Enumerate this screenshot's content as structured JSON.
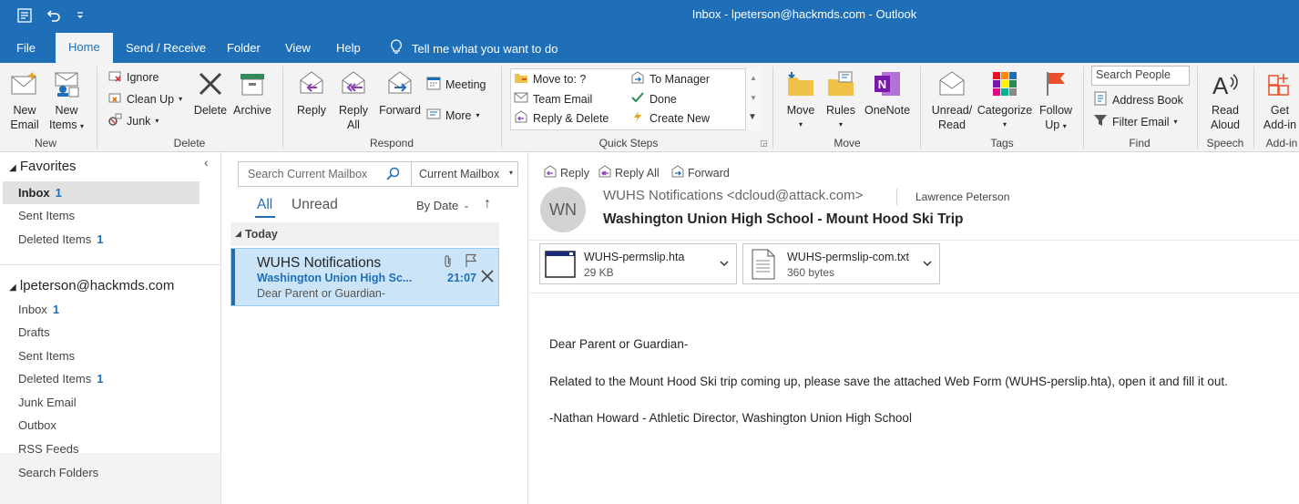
{
  "titlebar": {
    "title": "Inbox - lpeterson@hackmds.com  -  Outlook"
  },
  "tabs": [
    {
      "label": "File",
      "active": false
    },
    {
      "label": "Home",
      "active": true
    },
    {
      "label": "Send / Receive",
      "active": false
    },
    {
      "label": "Folder",
      "active": false
    },
    {
      "label": "View",
      "active": false
    },
    {
      "label": "Help",
      "active": false
    }
  ],
  "tell_me": "Tell me what you want to do",
  "ribbon": {
    "new": {
      "new_email_1": "New",
      "new_email_2": "Email",
      "new_items_1": "New",
      "new_items_2": "Items",
      "group": "New"
    },
    "delete": {
      "ignore": "Ignore",
      "clean_up": "Clean Up",
      "junk": "Junk",
      "delete": "Delete",
      "archive": "Archive",
      "group": "Delete"
    },
    "respond": {
      "reply": "Reply",
      "reply_all_1": "Reply",
      "reply_all_2": "All",
      "forward": "Forward",
      "meeting": "Meeting",
      "more": "More",
      "group": "Respond"
    },
    "quick_steps": {
      "move_to": "Move to: ?",
      "team_email": "Team Email",
      "reply_delete": "Reply & Delete",
      "to_manager": "To Manager",
      "done": "Done",
      "create_new": "Create New",
      "group": "Quick Steps"
    },
    "move": {
      "move": "Move",
      "rules": "Rules",
      "onenote": "OneNote",
      "group": "Move"
    },
    "tags": {
      "unread_read_1": "Unread/",
      "unread_read_2": "Read",
      "categorize": "Categorize",
      "follow_up_1": "Follow",
      "follow_up_2": "Up",
      "group": "Tags"
    },
    "find": {
      "search_people": "Search People",
      "address_book": "Address Book",
      "filter_email": "Filter Email",
      "group": "Find"
    },
    "speech": {
      "read_aloud_1": "Read",
      "read_aloud_2": "Aloud",
      "group": "Speech"
    },
    "addins": {
      "get_addins_1": "Get",
      "get_addins_2": "Add-in",
      "group": "Add-in"
    }
  },
  "folders": {
    "favorites_header": "Favorites",
    "favorites": [
      {
        "label": "Inbox",
        "count": "1"
      },
      {
        "label": "Sent Items",
        "count": ""
      },
      {
        "label": "Deleted Items",
        "count": "1"
      }
    ],
    "account_header": "lpeterson@hackmds.com",
    "account_items": [
      {
        "label": "Inbox",
        "count": "1"
      },
      {
        "label": "Drafts",
        "count": ""
      },
      {
        "label": "Sent Items",
        "count": ""
      },
      {
        "label": "Deleted Items",
        "count": "1"
      },
      {
        "label": "Junk Email",
        "count": ""
      },
      {
        "label": "Outbox",
        "count": ""
      },
      {
        "label": "RSS Feeds",
        "count": ""
      },
      {
        "label": "Search Folders",
        "count": ""
      }
    ]
  },
  "message_list": {
    "search_placeholder": "Search Current Mailbox",
    "scope": "Current Mailbox",
    "filter_all": "All",
    "filter_unread": "Unread",
    "sort": "By Date",
    "group_today": "Today",
    "message": {
      "sender": "WUHS Notifications",
      "subject": "Washington Union High Sc...",
      "time": "21:07",
      "preview": "Dear Parent or Guardian-"
    }
  },
  "reading": {
    "actions": {
      "reply": "Reply",
      "reply_all": "Reply All",
      "forward": "Forward"
    },
    "avatar": "WN",
    "from": "WUHS Notifications <dcloud@attack.com>",
    "to": "Lawrence Peterson",
    "subject": "Washington Union High School - Mount Hood Ski Trip",
    "attachments": [
      {
        "name": "WUHS-permslip.hta",
        "size": "29 KB"
      },
      {
        "name": "WUHS-permslip-com.txt",
        "size": "360 bytes"
      }
    ],
    "body": [
      "Dear Parent or Guardian-",
      "Related to the Mount Hood Ski trip coming up, please save the attached Web Form (WUHS-perslip.hta), open it and fill it out.",
      "-Nathan Howard - Athletic Director, Washington Union High School"
    ]
  },
  "colors": {
    "accent": "#1e6fb8",
    "selected_row": "#cce4f7",
    "ribbon_bg": "#f3f3f3"
  }
}
